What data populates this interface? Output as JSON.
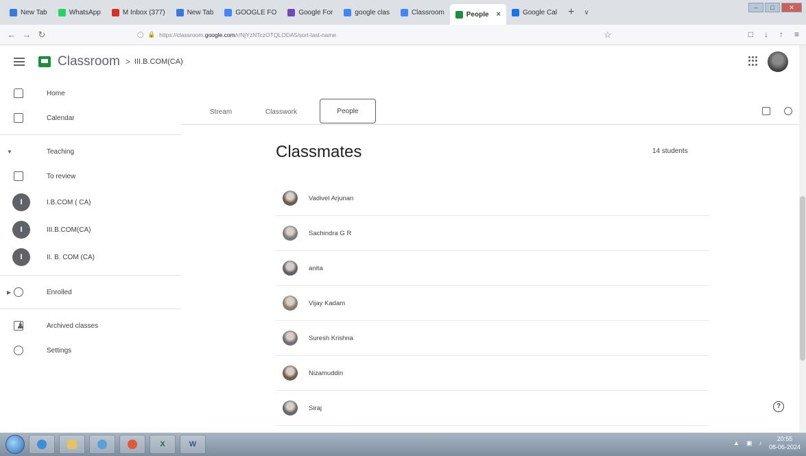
{
  "browser": {
    "tabs": [
      {
        "label": "New Tab",
        "color": "#3c78d8"
      },
      {
        "label": "WhatsApp",
        "color": "#25d366"
      },
      {
        "label": "M Inbox (377)",
        "color": "#d93025"
      },
      {
        "label": "New Tab",
        "color": "#3c78d8"
      },
      {
        "label": "GOOGLE FO",
        "color": "#4285f4"
      },
      {
        "label": "Google For",
        "color": "#7248b9"
      },
      {
        "label": "google clas",
        "color": "#4285f4"
      },
      {
        "label": "Classroom",
        "color": "#4285f4"
      },
      {
        "label": "People",
        "color": "#1e8e3e",
        "active": true
      },
      {
        "label": "Google Cal",
        "color": "#1a73e8"
      }
    ],
    "new_tab_glyph": "+",
    "url_host": "google.com",
    "url_prefix": "https://classroom.",
    "url_path": "/r/NjYzNTczOTQLODA5/sort-last-name"
  },
  "app": {
    "title": "Classroom",
    "breadcrumb_sep": ">",
    "breadcrumb": "III.B.COM(CA)"
  },
  "sidebar": {
    "home": "Home",
    "calendar": "Calendar",
    "teaching": "Teaching",
    "to_review": "To review",
    "classes": [
      {
        "initial": "I",
        "label": "I.B.COM ( CA)",
        "color": "#5f6368"
      },
      {
        "initial": "I",
        "label": "III.B.COM(CA)",
        "color": "#5f6368"
      },
      {
        "initial": "I",
        "label": "II. B. COM (CA)",
        "color": "#5f6368"
      }
    ],
    "enrolled": "Enrolled",
    "archived": "Archived classes",
    "settings": "Settings"
  },
  "nav": {
    "stream": "Stream",
    "classwork": "Classwork",
    "people": "People"
  },
  "main": {
    "section_title": "Classmates",
    "count": "14 students",
    "people": [
      {
        "name": "Vadivel Arjunan",
        "color": "#6b5a4e"
      },
      {
        "name": "Sachindra G R",
        "color": "#7a7a7a"
      },
      {
        "name": "anita",
        "color": "#5f6368"
      },
      {
        "name": "Vijay Kadam",
        "color": "#8c7a6a"
      },
      {
        "name": "Suresh Krishna",
        "color": "#6f6f6f"
      },
      {
        "name": "Nizamuddin",
        "color": "#705c4c"
      },
      {
        "name": "Siraj",
        "color": "#676767"
      }
    ]
  },
  "taskbar": {
    "excel": "X",
    "word": "W",
    "time": "20:55",
    "date": "08-06-2024"
  }
}
